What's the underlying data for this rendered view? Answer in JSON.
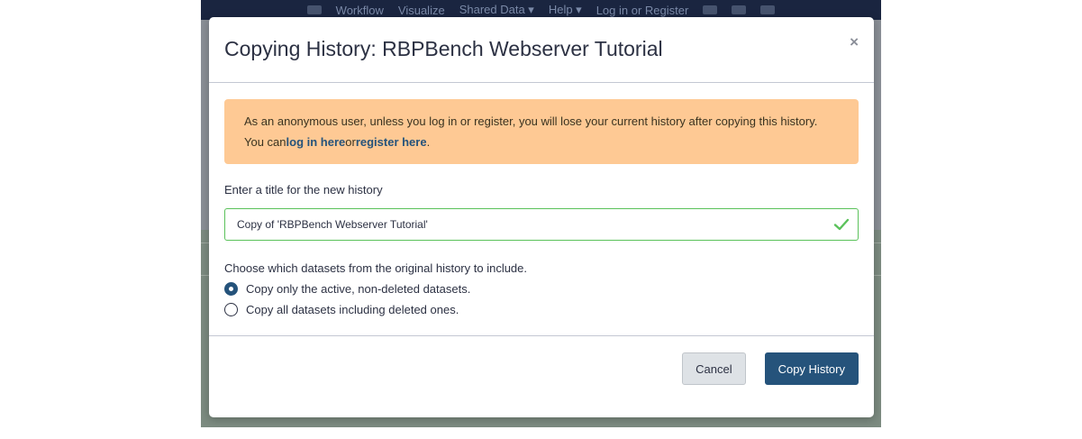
{
  "app": {
    "nav_items": [
      "Workflow",
      "Visualize",
      "Shared Data ▾",
      "Help ▾",
      "Log in or Register"
    ]
  },
  "modal": {
    "title": "Copying History: RBPBench Webserver Tutorial",
    "close_label": "×",
    "alert": {
      "text_before": "As an anonymous user, unless you log in or register, you will lose your current history after copying this history. You can",
      "login_link": "log in here",
      "middle": "or",
      "register_link": "register here",
      "text_after": "."
    },
    "title_field": {
      "label": "Enter a title for the new history",
      "value": "Copy of 'RBPBench Webserver Tutorial'"
    },
    "datasets": {
      "label": "Choose which datasets from the original history to include.",
      "options": [
        {
          "label": "Copy only the active, non-deleted datasets.",
          "checked": true
        },
        {
          "label": "Copy all datasets including deleted ones.",
          "checked": false
        }
      ]
    },
    "footer": {
      "cancel_label": "Cancel",
      "submit_label": "Copy History"
    }
  },
  "colors": {
    "primary": "#25537b",
    "alert_bg": "#fec994",
    "valid_border": "#5bc25b"
  }
}
